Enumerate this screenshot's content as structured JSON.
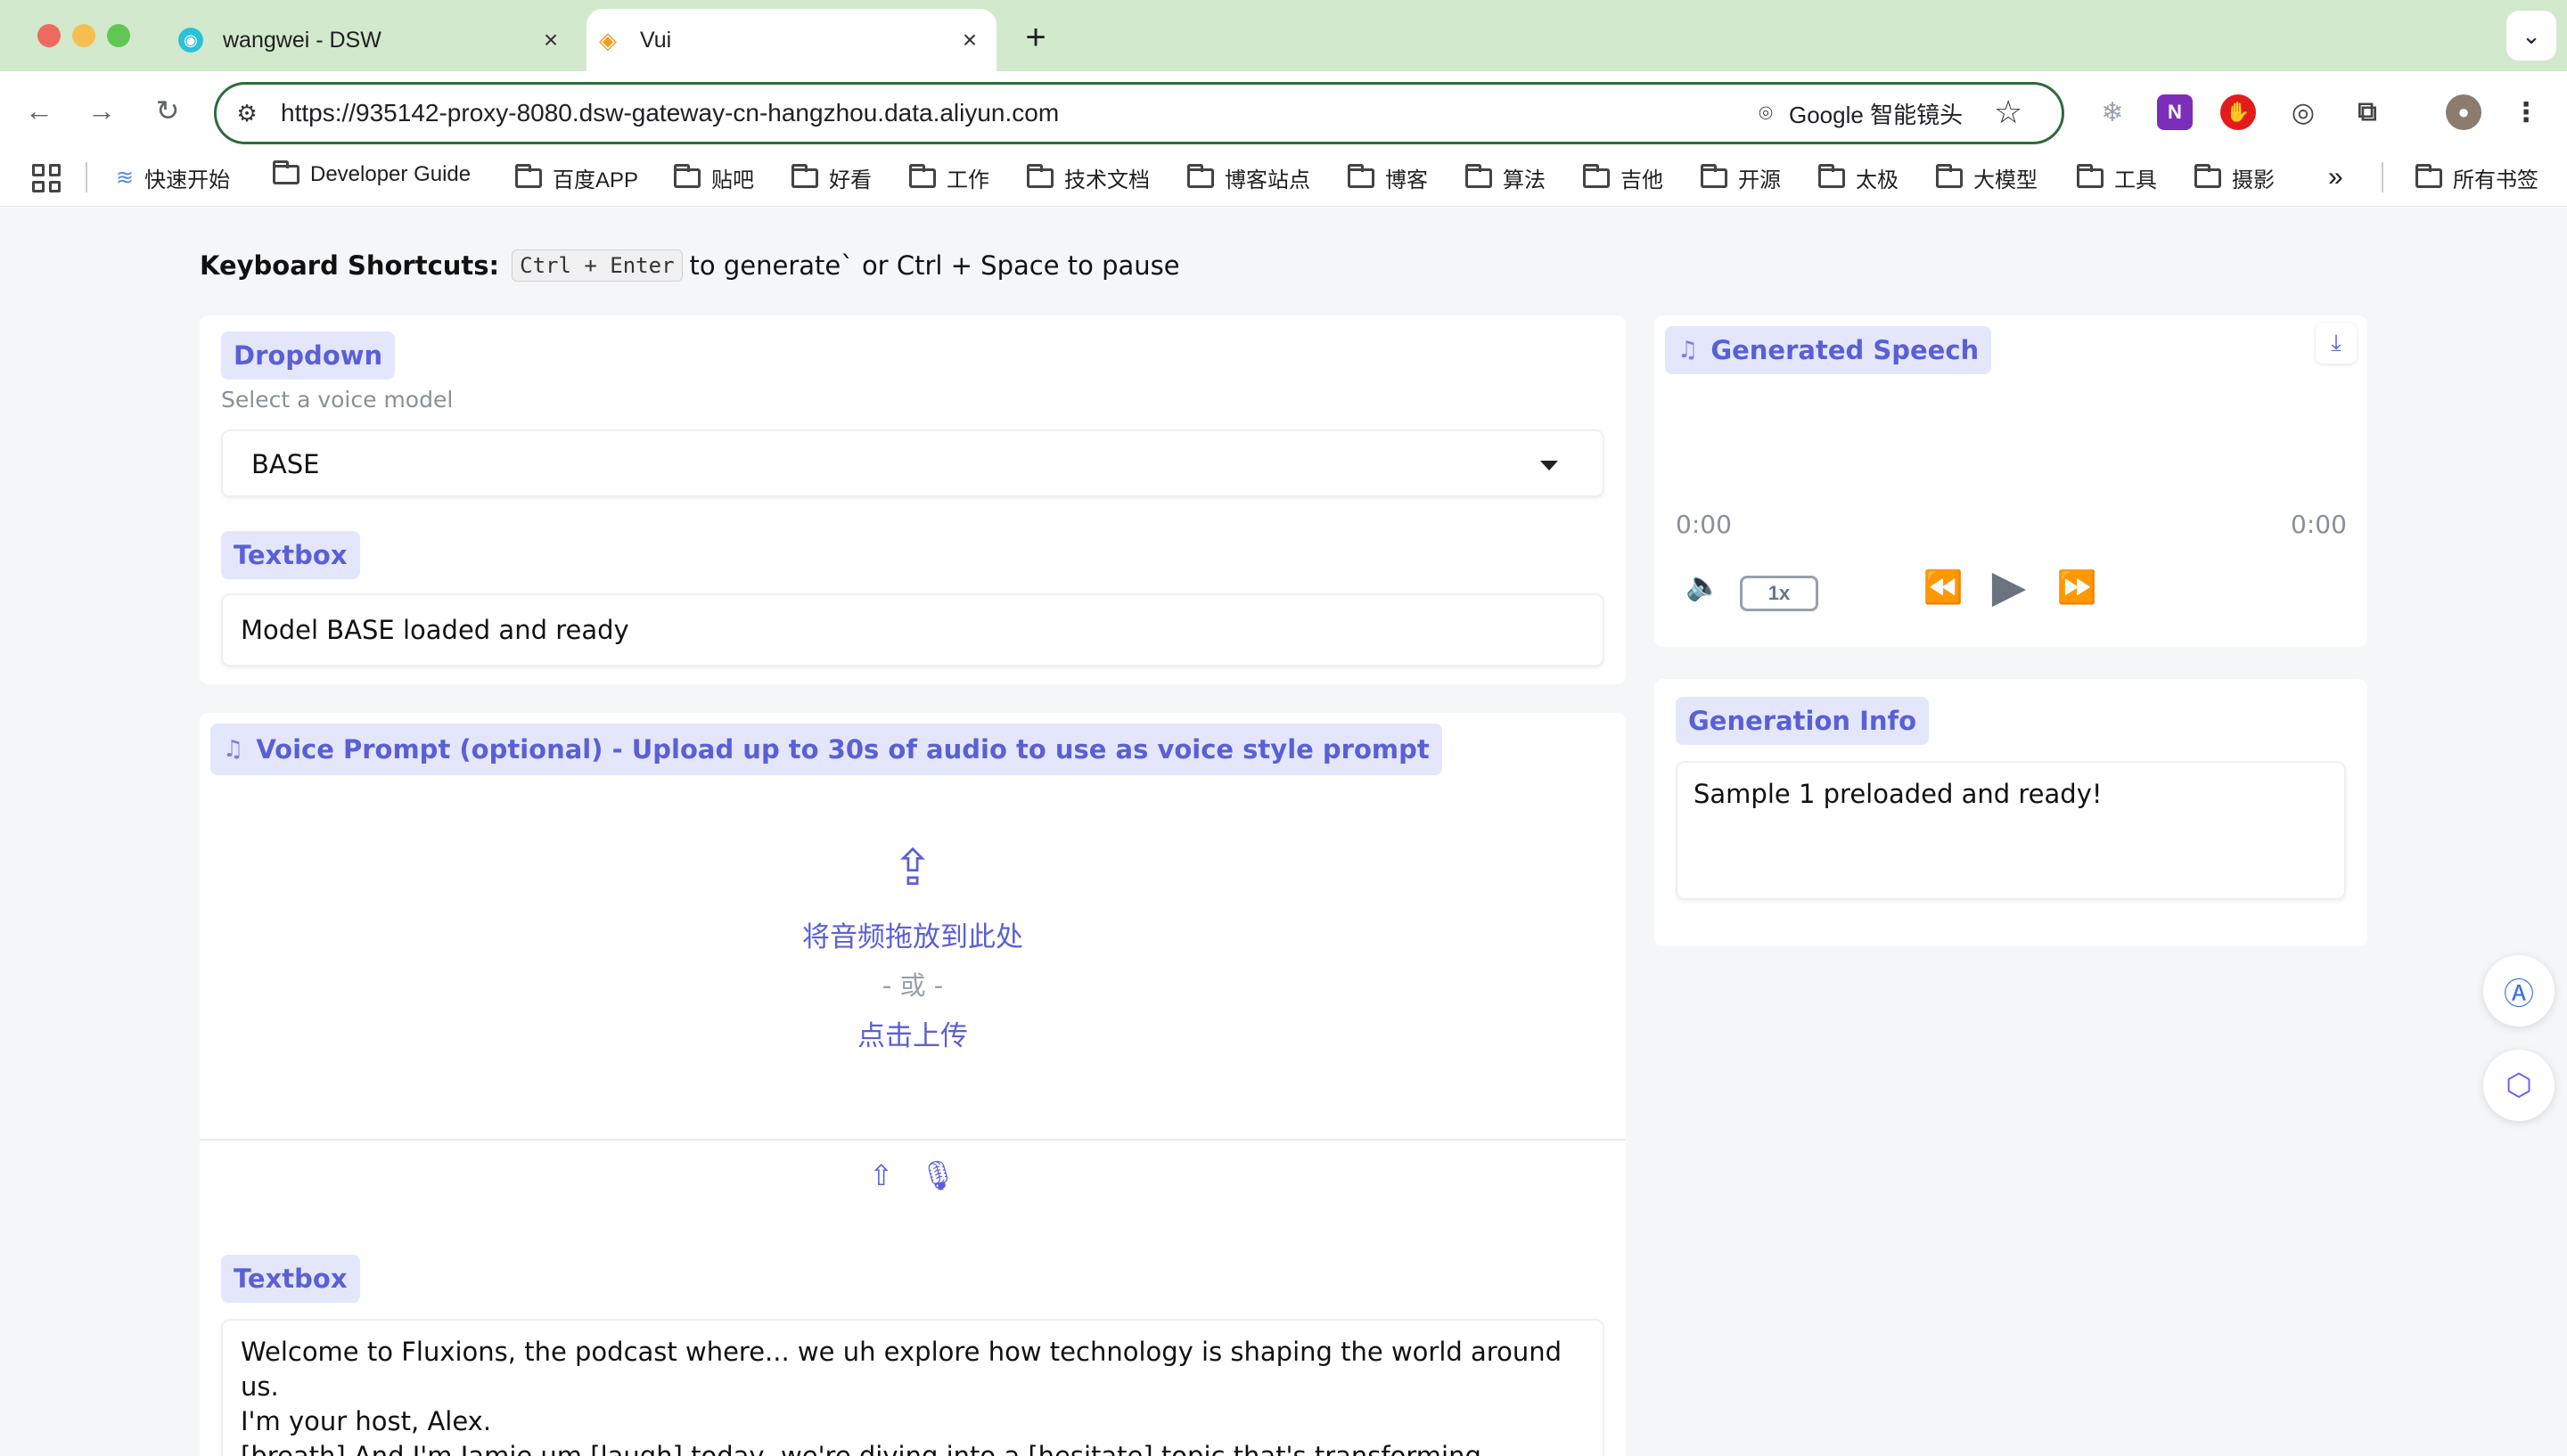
{
  "browser": {
    "tabs": [
      {
        "title": "wangwei - DSW",
        "icon": "dsw-favicon"
      },
      {
        "title": "Vui",
        "icon": "vui-favicon"
      }
    ],
    "url": "https://935142-proxy-8080.dsw-gateway-cn-hangzhou.data.aliyun.com",
    "lens_label": "Google 智能镜头",
    "bookmarks": [
      "快速开始",
      "Developer Guide",
      "百度APP",
      "贴吧",
      "好看",
      "工作",
      "技术文档",
      "博客站点",
      "博客",
      "算法",
      "吉他",
      "开源",
      "太极",
      "大模型",
      "工具",
      "摄影"
    ],
    "all_bookmarks": "所有书签"
  },
  "shortcuts": {
    "title": "Keyboard Shortcuts:",
    "key": "Ctrl + Enter",
    "text": "to generate` or Ctrl + Space to pause"
  },
  "dropdown": {
    "label": "Dropdown",
    "info": "Select a voice model",
    "value": "BASE"
  },
  "status_box": {
    "label": "Textbox",
    "value": "Model BASE loaded and ready"
  },
  "voice_prompt": {
    "label": "Voice Prompt (optional) - Upload up to 30s of audio to use as voice style prompt",
    "drop_text": "将音频拖放到此处",
    "or_text": "- 或 -",
    "click_text": "点击上传"
  },
  "script_box": {
    "label": "Textbox",
    "lines": [
      "Welcome to Fluxions, the podcast where... we uh explore how technology is shaping the world around us.",
      "I'm your host, Alex.",
      "[breath] And I'm Jamie um [laugh] today, we're diving into a [hesitate] topic that's transforming customer"
    ]
  },
  "generated_speech": {
    "label": "Generated Speech",
    "current_time": "0:00",
    "duration": "0:00",
    "speed": "1x"
  },
  "generation_info": {
    "label": "Generation Info",
    "value": "Sample 1 preloaded and ready!"
  },
  "colors": {
    "accent": "#5b5fd6",
    "chip_bg": "#e4e7fb",
    "titlebar": "#d3e9ce",
    "page_bg": "#f5f6f8"
  }
}
